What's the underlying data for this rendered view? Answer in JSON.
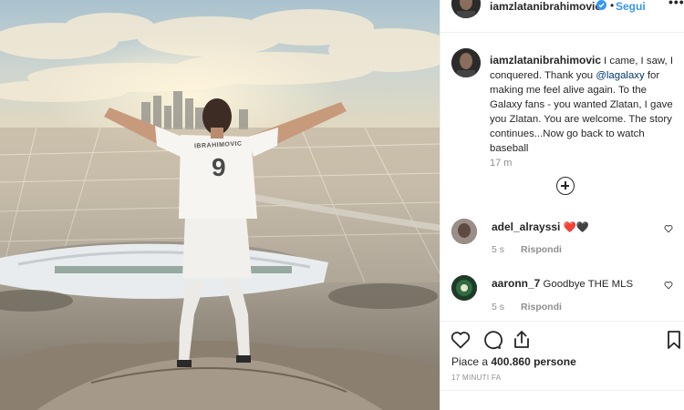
{
  "photo": {
    "description_icon": "photo",
    "jersey_name": "IBRAHIMOVIC",
    "jersey_number": "9"
  },
  "header": {
    "username": "iamzlatanibrahimovic",
    "separator": "•",
    "follow_label": "Segui",
    "more_label": "•••"
  },
  "caption": {
    "username": "iamzlatanibrahimovic",
    "text_before_mention": "I came, I saw, I conquered. Thank you ",
    "mention": "@lagalaxy",
    "text_after_mention": " for making me feel alive again. To the Galaxy fans - you wanted Zlatan, I gave you Zlatan. You are welcome. The story continues...Now go back to watch baseball",
    "time": "17 m"
  },
  "comments": [
    {
      "username": "adel_alrayssi",
      "text": "❤️🖤",
      "time": "5 s",
      "reply_label": "Rispondi"
    },
    {
      "username": "aaronn_7",
      "text": "Goodbye THE MLS",
      "time": "5 s",
      "reply_label": "Rispondi"
    }
  ],
  "likes": {
    "prefix": "Piace a ",
    "count": "400.860 persone"
  },
  "timestamp": "17 MINUTI FA",
  "colors": {
    "link": "#00376b",
    "follow": "#3897f0",
    "verified": "#3897f0",
    "heart": "#ed4956"
  },
  "icons": [
    "heart-icon",
    "comment-icon",
    "share-icon",
    "bookmark-icon",
    "add-comments-icon",
    "verified-badge-icon",
    "more-options-icon"
  ]
}
